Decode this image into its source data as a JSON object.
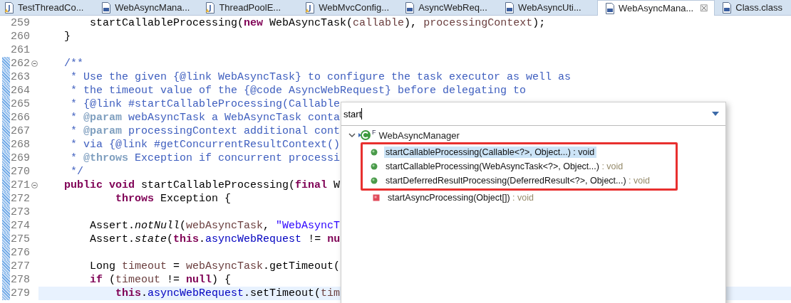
{
  "tabs": [
    {
      "label": "TestThreadCo...",
      "kind": "java",
      "selected": false
    },
    {
      "label": "WebAsyncMana...",
      "kind": "class",
      "selected": false
    },
    {
      "label": "ThreadPoolE...",
      "kind": "java",
      "selected": false
    },
    {
      "label": "WebMvcConfig...",
      "kind": "java",
      "selected": false
    },
    {
      "label": "AsyncWebReq...",
      "kind": "class",
      "selected": false
    },
    {
      "label": "WebAsyncUti...",
      "kind": "class",
      "selected": false
    },
    {
      "label": "WebAsyncMana...",
      "kind": "class",
      "selected": true
    },
    {
      "label": "Class.class",
      "kind": "class",
      "selected": false
    }
  ],
  "close_tab": "☒",
  "editor": {
    "lines": [
      {
        "number": "259",
        "changed": false,
        "fold": false,
        "current": false,
        "tokens": [
          {
            "kind": "plain",
            "text": "        startCallableProcessing("
          },
          {
            "kind": "keyword",
            "text": "new"
          },
          {
            "kind": "plain",
            "text": " WebAsyncTask("
          },
          {
            "kind": "variable",
            "text": "callable"
          },
          {
            "kind": "plain",
            "text": "), "
          },
          {
            "kind": "variable",
            "text": "processingContext"
          },
          {
            "kind": "plain",
            "text": ");"
          }
        ]
      },
      {
        "number": "260",
        "changed": false,
        "fold": false,
        "current": false,
        "tokens": [
          {
            "kind": "plain",
            "text": "    }"
          }
        ]
      },
      {
        "number": "261",
        "changed": false,
        "fold": false,
        "current": false
      },
      {
        "number": "262",
        "changed": true,
        "fold": true,
        "current": false,
        "tokens": [
          {
            "kind": "comment",
            "text": "    /**"
          }
        ]
      },
      {
        "number": "263",
        "changed": true,
        "fold": false,
        "current": false,
        "tokens": [
          {
            "kind": "comment",
            "text": "     * Use the given {@link WebAsyncTask} to configure the task executor as well as"
          }
        ]
      },
      {
        "number": "264",
        "changed": true,
        "fold": false,
        "current": false,
        "tokens": [
          {
            "kind": "comment",
            "text": "     * the timeout value of the {@code AsyncWebRequest} before delegating to"
          }
        ]
      },
      {
        "number": "265",
        "changed": true,
        "fold": false,
        "current": false,
        "tokens": [
          {
            "kind": "comment",
            "text": "     * {@link #startCallableProcessing(Callable"
          }
        ]
      },
      {
        "number": "266",
        "changed": true,
        "fold": false,
        "current": false,
        "tokens": [
          {
            "kind": "comment",
            "text": "     * "
          },
          {
            "kind": "tag",
            "text": "@param"
          },
          {
            "kind": "comment",
            "text": " webAsyncTask a WebAsyncTask conta"
          }
        ]
      },
      {
        "number": "267",
        "changed": true,
        "fold": false,
        "current": false,
        "tokens": [
          {
            "kind": "comment",
            "text": "     * "
          },
          {
            "kind": "tag",
            "text": "@param"
          },
          {
            "kind": "comment",
            "text": " processingContext additional cont"
          }
        ]
      },
      {
        "number": "268",
        "changed": true,
        "fold": false,
        "current": false,
        "tokens": [
          {
            "kind": "comment",
            "text": "     * via {@link #getConcurrentResultContext()"
          }
        ]
      },
      {
        "number": "269",
        "changed": true,
        "fold": false,
        "current": false,
        "tokens": [
          {
            "kind": "comment",
            "text": "     * "
          },
          {
            "kind": "tag",
            "text": "@throws"
          },
          {
            "kind": "comment",
            "text": " Exception if concurrent processi"
          }
        ]
      },
      {
        "number": "270",
        "changed": true,
        "fold": false,
        "current": false,
        "tokens": [
          {
            "kind": "comment",
            "text": "     */"
          }
        ]
      },
      {
        "number": "271",
        "changed": true,
        "fold": true,
        "current": false,
        "tokens": [
          {
            "kind": "keyword",
            "text": "    public void"
          },
          {
            "kind": "plain",
            "text": " startCallableProcessing("
          },
          {
            "kind": "keyword",
            "text": "final"
          },
          {
            "kind": "plain",
            "text": " W"
          }
        ]
      },
      {
        "number": "272",
        "changed": true,
        "fold": false,
        "current": false,
        "tokens": [
          {
            "kind": "keyword",
            "text": "            throws"
          },
          {
            "kind": "plain",
            "text": " Exception {"
          }
        ]
      },
      {
        "number": "273",
        "changed": true,
        "fold": false,
        "current": false
      },
      {
        "number": "274",
        "changed": true,
        "fold": false,
        "current": false,
        "tokens": [
          {
            "kind": "plain",
            "text": "        Assert."
          },
          {
            "kind": "static",
            "text": "notNull"
          },
          {
            "kind": "plain",
            "text": "("
          },
          {
            "kind": "variable",
            "text": "webAsyncTask"
          },
          {
            "kind": "plain",
            "text": ", "
          },
          {
            "kind": "string",
            "text": "\"WebAsyncT"
          }
        ]
      },
      {
        "number": "275",
        "changed": true,
        "fold": false,
        "current": false,
        "tokens": [
          {
            "kind": "plain",
            "text": "        Assert."
          },
          {
            "kind": "static",
            "text": "state"
          },
          {
            "kind": "plain",
            "text": "("
          },
          {
            "kind": "keyword",
            "text": "this"
          },
          {
            "kind": "plain",
            "text": "."
          },
          {
            "kind": "field",
            "text": "asyncWebRequest"
          },
          {
            "kind": "plain",
            "text": " != "
          },
          {
            "kind": "keyword",
            "text": "nu"
          }
        ]
      },
      {
        "number": "276",
        "changed": true,
        "fold": false,
        "current": false
      },
      {
        "number": "277",
        "changed": true,
        "fold": false,
        "current": false,
        "tokens": [
          {
            "kind": "plain",
            "text": "        Long "
          },
          {
            "kind": "variable",
            "text": "timeout"
          },
          {
            "kind": "plain",
            "text": " = "
          },
          {
            "kind": "variable",
            "text": "webAsyncTask"
          },
          {
            "kind": "plain",
            "text": ".getTimeout("
          }
        ]
      },
      {
        "number": "278",
        "changed": true,
        "fold": false,
        "current": false,
        "tokens": [
          {
            "kind": "keyword",
            "text": "        if"
          },
          {
            "kind": "plain",
            "text": " ("
          },
          {
            "kind": "variable",
            "text": "timeout"
          },
          {
            "kind": "plain",
            "text": " != "
          },
          {
            "kind": "keyword",
            "text": "null"
          },
          {
            "kind": "plain",
            "text": ") {"
          }
        ]
      },
      {
        "number": "279",
        "changed": true,
        "fold": false,
        "current": true,
        "tokens": [
          {
            "kind": "keyword",
            "text": "            this"
          },
          {
            "kind": "plain",
            "text": "."
          },
          {
            "kind": "field",
            "text": "asyncWebRequest"
          },
          {
            "kind": "plain",
            "text": ".setTimeout("
          },
          {
            "kind": "variable",
            "text": "tim"
          }
        ]
      }
    ]
  },
  "quick_outline": {
    "filter": "start",
    "tree": {
      "name": "WebAsyncManager",
      "badge": "F",
      "expanded": true,
      "children": [
        {
          "name": "startCallableProcessing(Callable<?>, Object...)",
          "type": " : void",
          "kind": "public",
          "selected": true,
          "annotated": true
        },
        {
          "name": "startCallableProcessing(WebAsyncTask<?>, Object...)",
          "type": " : void",
          "kind": "public",
          "selected": false,
          "annotated": true
        },
        {
          "name": "startDeferredResultProcessing(DeferredResult<?>, Object...)",
          "type": " : void",
          "kind": "public",
          "selected": false,
          "annotated": true
        },
        {
          "name": "startAsyncProcessing(Object[])",
          "type": " : void",
          "kind": "private",
          "selected": false,
          "annotated": false
        }
      ]
    }
  }
}
